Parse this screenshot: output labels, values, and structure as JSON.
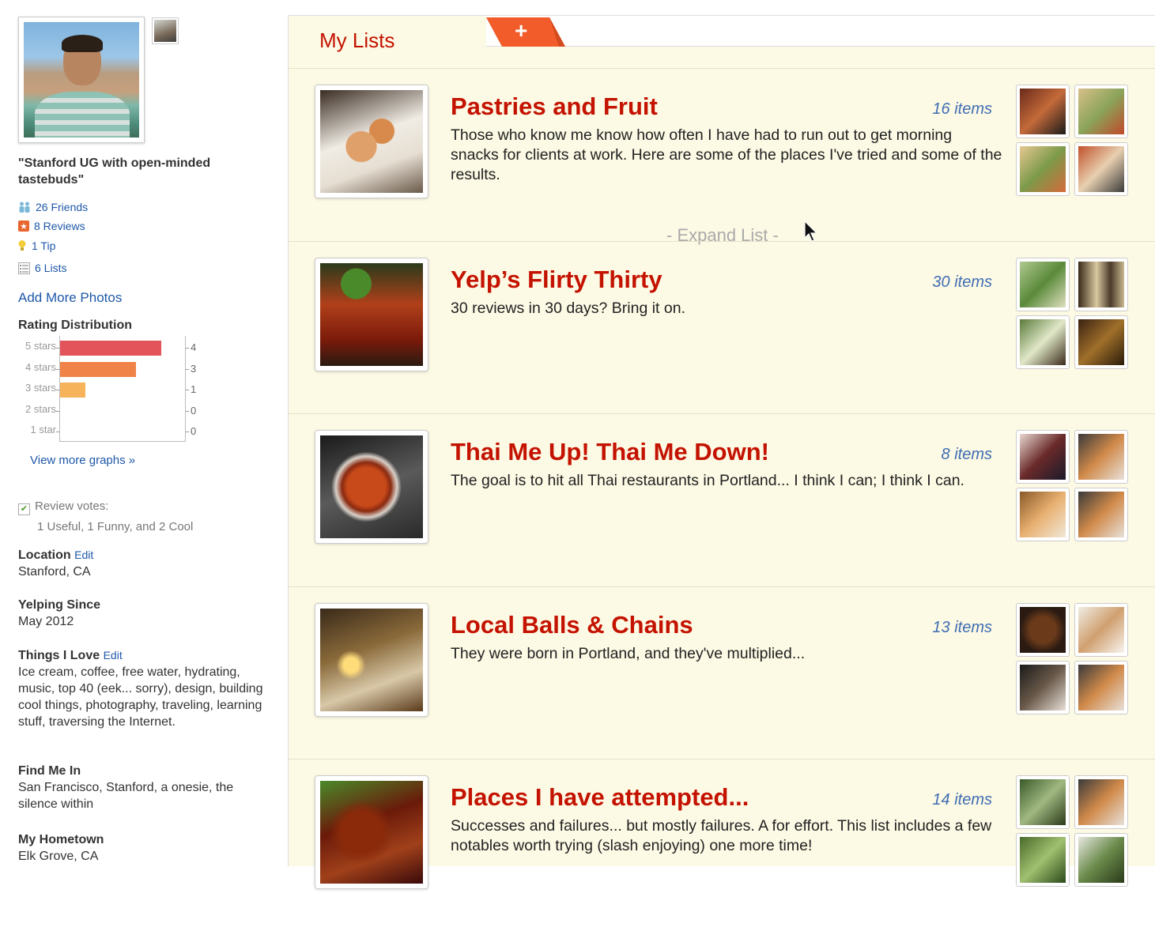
{
  "profile": {
    "tagline": "\"Stanford UG with open-minded tastebuds\"",
    "stats": [
      {
        "icon": "friends-icon",
        "label": "26 Friends"
      },
      {
        "icon": "reviews-icon",
        "label": "8 Reviews"
      },
      {
        "icon": "tip-icon",
        "label": "1 Tip"
      },
      {
        "icon": "lists-icon",
        "label": "6 Lists"
      }
    ],
    "add_photos": "Add More Photos",
    "rating_title": "Rating Distribution",
    "view_graphs": "View more graphs »",
    "votes_label": "Review votes:",
    "votes_detail": "1 Useful, 1 Funny, and 2 Cool",
    "location_label": "Location",
    "location_edit": "Edit",
    "location": "Stanford, CA",
    "since_label": "Yelping Since",
    "since": "May 2012",
    "love_label": "Things I Love",
    "love_edit": "Edit",
    "love": "Ice cream, coffee, free water, hydrating, music, top 40 (eek... sorry), design, building cool things, photography, traveling, learning stuff, traversing the Internet.",
    "findme_label": "Find Me In",
    "findme": "San Francisco, Stanford, a onesie, the silence within",
    "hometown_label": "My Hometown",
    "hometown": "Elk Grove, CA"
  },
  "chart_data": {
    "type": "bar",
    "title": "Rating Distribution",
    "categories": [
      "5 stars",
      "4 stars",
      "3 stars",
      "2 stars",
      "1 star"
    ],
    "values": [
      4,
      3,
      1,
      0,
      0
    ],
    "xlim": [
      0,
      5
    ],
    "colors": [
      "#e3545a",
      "#f08448",
      "#f6b35a",
      "#fcd36a",
      "#fde39d"
    ]
  },
  "main": {
    "title": "My Lists",
    "add_label": "+",
    "expand_label": "- Expand List -",
    "lists": [
      {
        "title": "Pastries and Fruit",
        "count": "16 items",
        "desc": "Those who know me know how often I have had to run out to get morning snacks for clients at work. Here are some of the places I've tried and some of the results."
      },
      {
        "title": "Yelp’s Flirty Thirty",
        "count": "30 items",
        "desc": "30 reviews in 30 days? Bring it on."
      },
      {
        "title": "Thai Me Up! Thai Me Down!",
        "count": "8 items",
        "desc": "The goal is to hit all Thai restaurants in Portland... I think I can; I think I can."
      },
      {
        "title": "Local Balls & Chains",
        "count": "13 items",
        "desc": "They were born in Portland, and they've multiplied..."
      },
      {
        "title": "Places I have attempted...",
        "count": "14 items",
        "desc": "Successes and failures... but mostly failures. A for effort. This list includes a few notables worth trying (slash enjoying) one more time!"
      }
    ]
  }
}
